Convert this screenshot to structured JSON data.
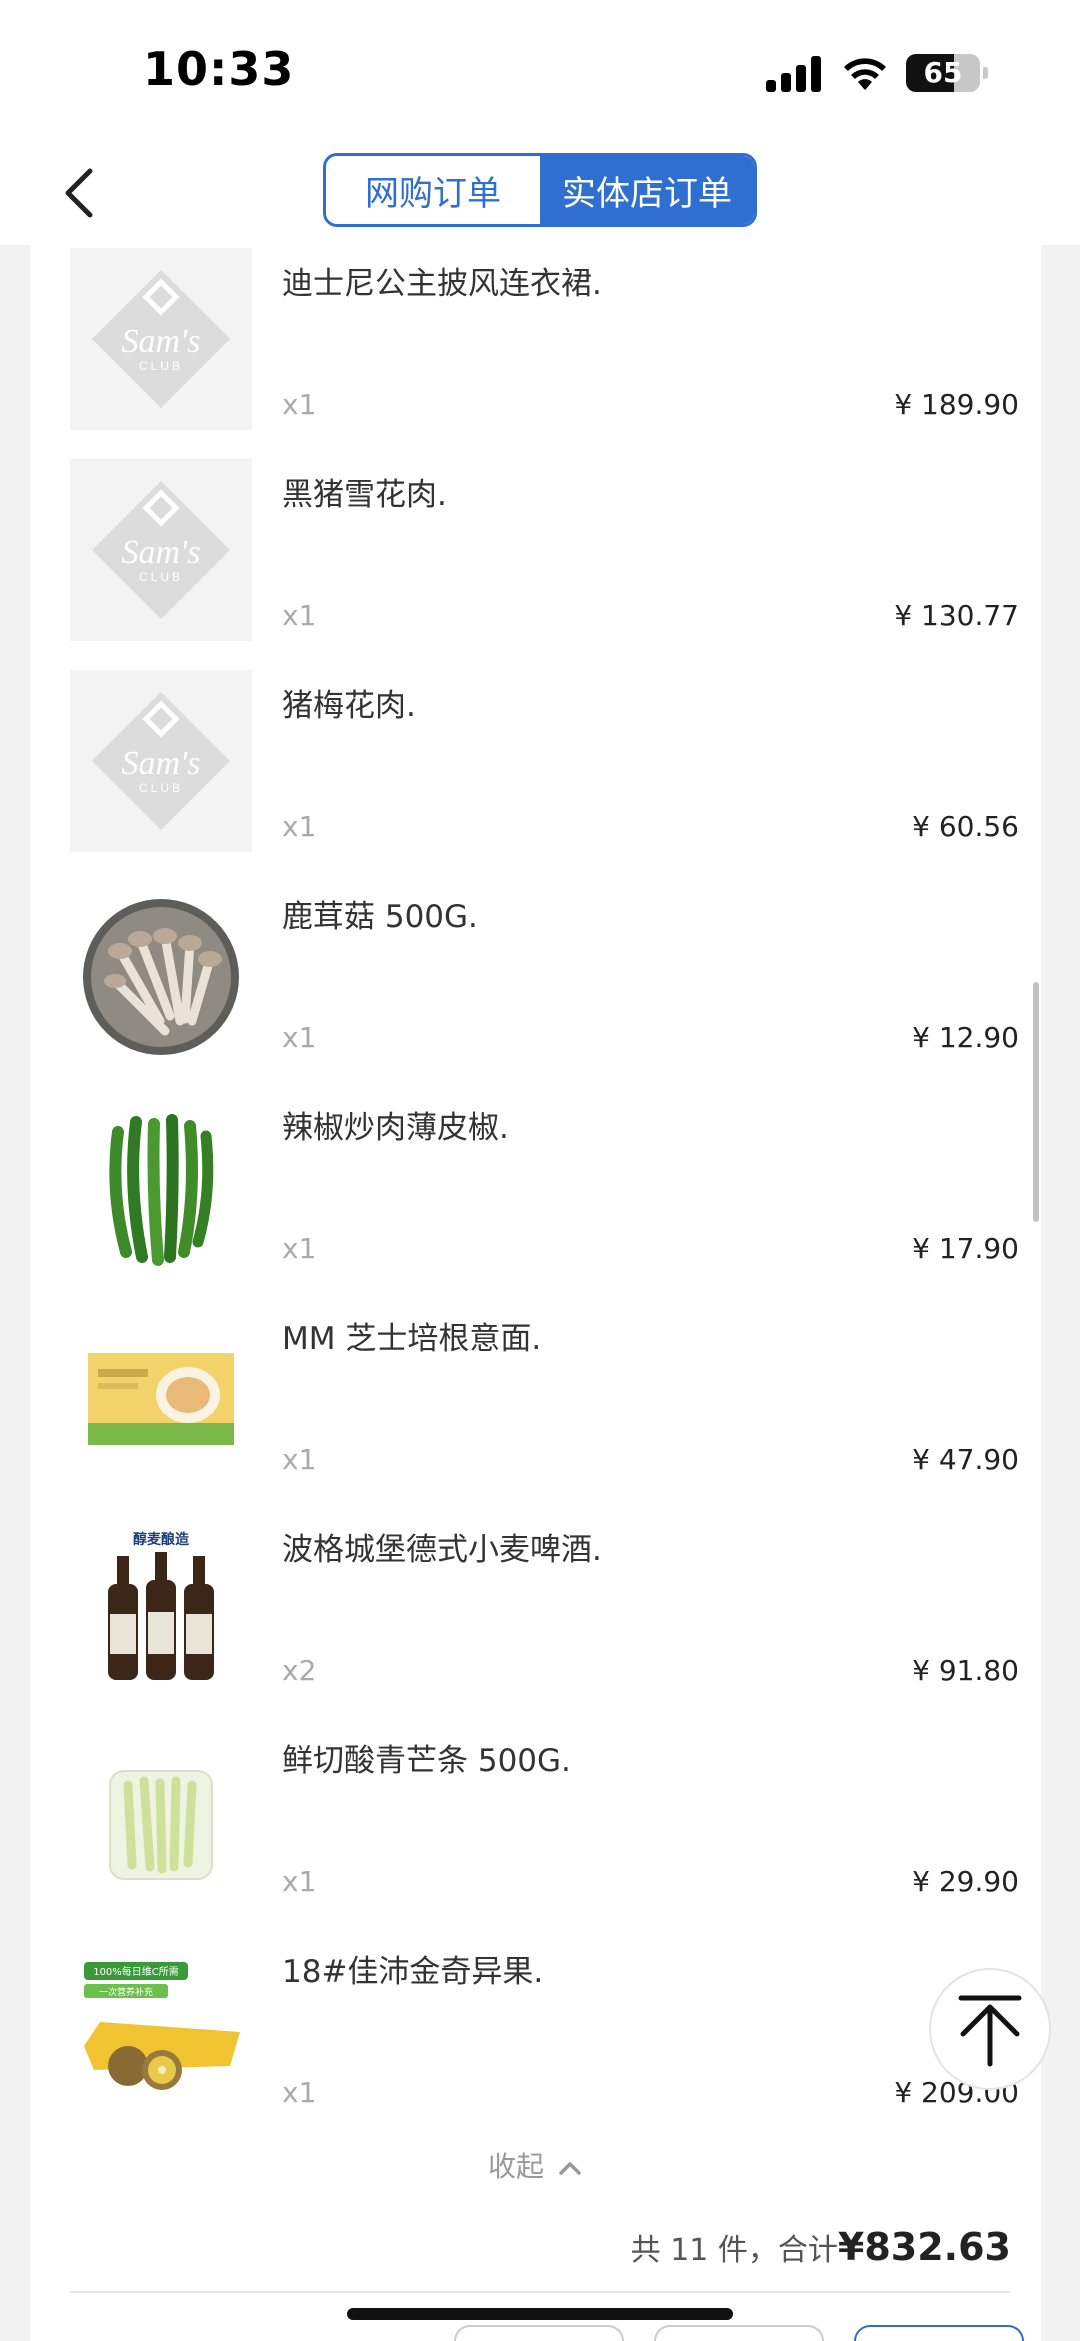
{
  "status_bar": {
    "time": "10:33",
    "battery_level": "65"
  },
  "tabs": {
    "online": "网购订单",
    "store": "实体店订单"
  },
  "items": [
    {
      "name": "迪士尼公主披风连衣裙.",
      "qty": "x1",
      "price": "¥ 189.90",
      "image": "sams-club-placeholder"
    },
    {
      "name": "黑猪雪花肉.",
      "qty": "x1",
      "price": "¥ 130.77",
      "image": "sams-club-placeholder"
    },
    {
      "name": "猪梅花肉.",
      "qty": "x1",
      "price": "¥ 60.56",
      "image": "sams-club-placeholder"
    },
    {
      "name": "鹿茸菇 500G.",
      "qty": "x1",
      "price": "¥ 12.90",
      "image": "mushroom-bowl"
    },
    {
      "name": "辣椒炒肉薄皮椒.",
      "qty": "x1",
      "price": "¥ 17.90",
      "image": "green-chili-peppers"
    },
    {
      "name": "MM 芝士培根意面.",
      "qty": "x1",
      "price": "¥ 47.90",
      "image": "pasta-box"
    },
    {
      "name": "波格城堡德式小麦啤酒.",
      "qty": "x2",
      "price": "¥ 91.80",
      "image": "beer-bottles"
    },
    {
      "name": "鲜切酸青芒条 500G.",
      "qty": "x1",
      "price": "¥ 29.90",
      "image": "green-mango-strips"
    },
    {
      "name": "18#佳沛金奇异果.",
      "qty": "x1",
      "price": "¥ 209.00",
      "image": "golden-kiwi-box"
    }
  ],
  "placeholder_logo": {
    "line1": "Sam's",
    "line2": "CLUB"
  },
  "beer_label": {
    "banner": "醇麦酿造"
  },
  "kiwi_label": {
    "top": "100%每日维C所需",
    "sub": "一次营养补充"
  },
  "collapse_label": "收起",
  "summary": {
    "count_text": "共 11 件，合计",
    "total": "¥832.63"
  },
  "colors": {
    "accent": "#2f6fd1",
    "price": "#222222",
    "muted": "#aaaaaa"
  }
}
